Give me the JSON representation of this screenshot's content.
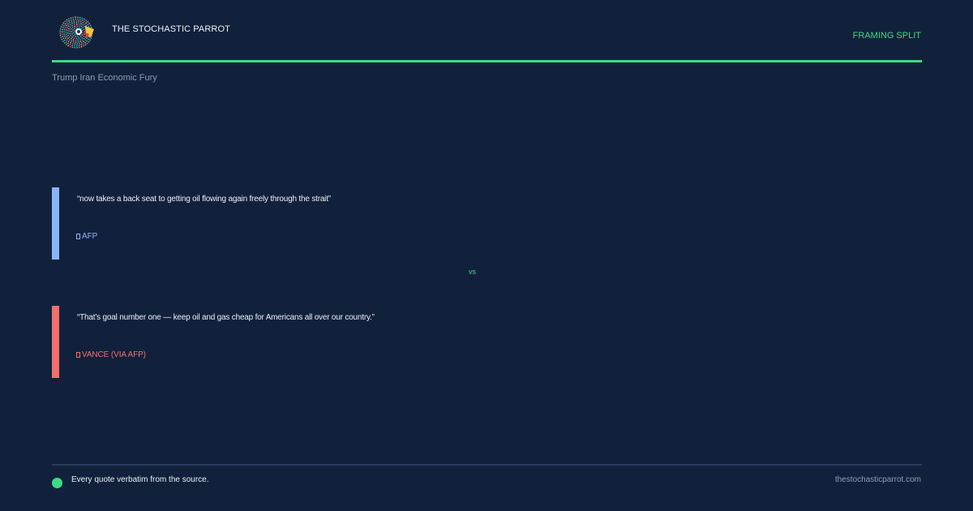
{
  "header": {
    "brand": "THE STOCHASTIC PARROT",
    "section_tag": "FRAMING SPLIT",
    "logo_icon": "parrot-logo-icon"
  },
  "topic": "Trump Iran Economic Fury",
  "quotes": [
    {
      "text": "“now takes a back seat to getting oil flowing again freely through the strait”",
      "source": "AFP",
      "accent_color": "#8ab4f8"
    },
    {
      "text": "“That’s goal number one — keep oil and gas cheap for Americans all over our country.”",
      "source": "VANCE (VIA AFP)",
      "accent_color": "#f0706a"
    }
  ],
  "vs_label": "vs",
  "footer": {
    "note": "Every quote verbatim from the source.",
    "url": "thestochasticparrot.com"
  },
  "colors": {
    "background": "#12213b",
    "accent_green": "#3ddc84",
    "muted_text": "#8f9bb0"
  }
}
